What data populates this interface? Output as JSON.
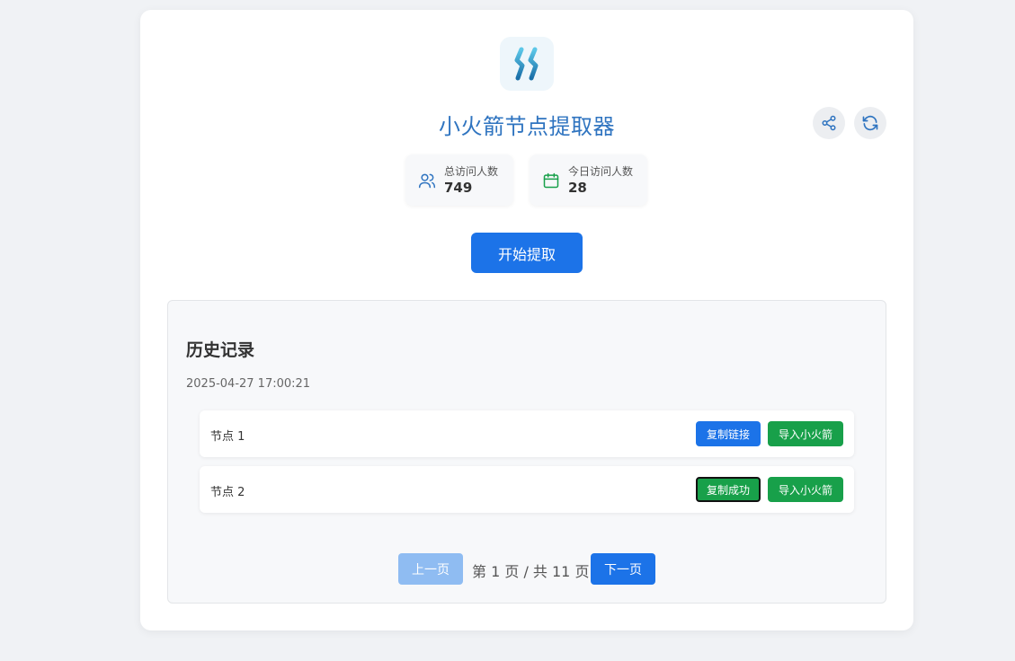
{
  "app": {
    "title": "小火箭节点提取器",
    "logo_icon": "rocket-logo-icon",
    "accent_color": "#1c73e8",
    "success_color": "#18a04a"
  },
  "actions": {
    "share_icon": "share-icon",
    "refresh_icon": "refresh-icon"
  },
  "stats": {
    "total_label": "总访问人数",
    "total_value": "749",
    "today_label": "今日访问人数",
    "today_value": "28"
  },
  "start_button": "开始提取",
  "history": {
    "title": "历史记录",
    "timestamp": "2025-04-27 17:00:21",
    "nodes": [
      {
        "label": "节点 1",
        "copy_label": "复制链接",
        "import_label": "导入小火箭"
      },
      {
        "label": "节点 2",
        "copy_label": "复制成功",
        "import_label": "导入小火箭"
      }
    ]
  },
  "pagination": {
    "prev_label": "上一页",
    "page_info": "第 1 页 / 共 11 页",
    "next_label": "下一页",
    "current_page": 1,
    "total_pages": 11
  }
}
